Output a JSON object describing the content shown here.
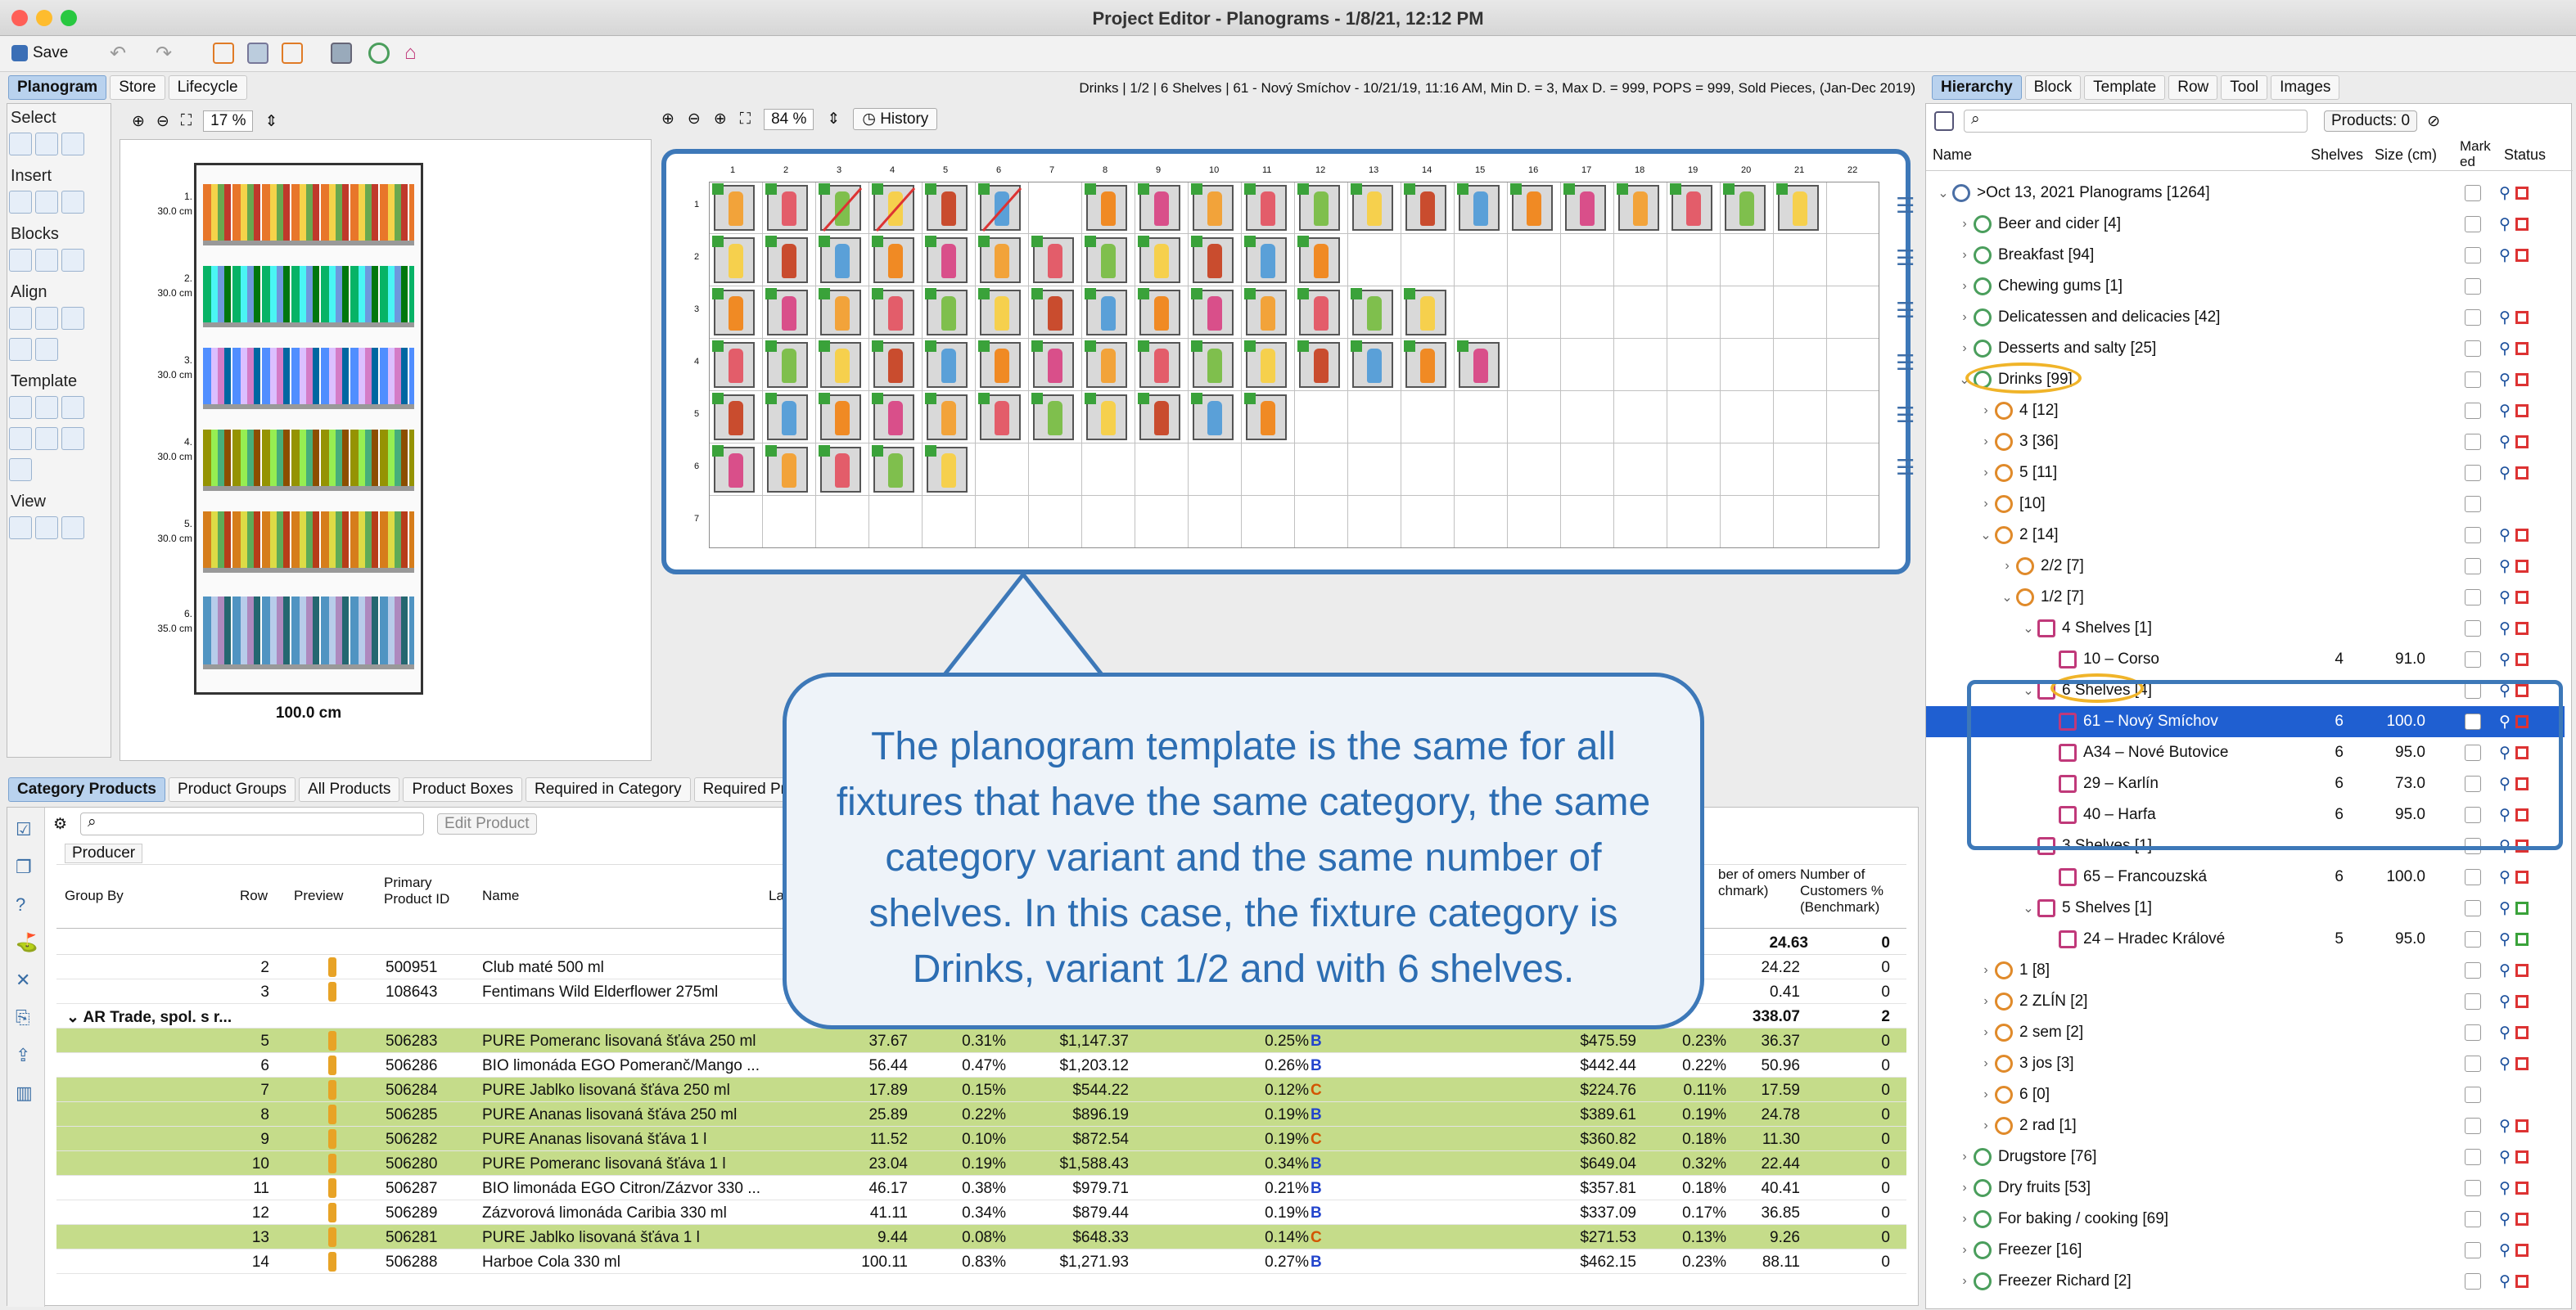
{
  "window": {
    "title": "Project Editor - Planograms - 1/8/21, 12:12 PM"
  },
  "toolbar": {
    "save_label": "Save"
  },
  "left_tabs": [
    "Planogram",
    "Store",
    "Lifecycle"
  ],
  "left_panel": {
    "zoom": "17 %",
    "sections": [
      "Select",
      "Insert",
      "Blocks",
      "Align",
      "Template",
      "View"
    ],
    "shelf_labels": [
      "1.",
      "2.",
      "3.",
      "4.",
      "5.",
      "6."
    ],
    "shelf_heights": [
      "30.0 cm",
      "30.0 cm",
      "30.0 cm",
      "30.0 cm",
      "30.0 cm",
      "35.0 cm"
    ],
    "width_label": "100.0 cm"
  },
  "center": {
    "info": "Drinks | 1/2 | 6 Shelves | 61 - Nový Smíchov - 10/21/19, 11:16 AM, Min D. = 3, Max D. = 999, POPS = 999, Sold Pieces, (Jan-Dec 2019)",
    "zoom": "84 %",
    "history_label": "History",
    "col_numbers": [
      "1",
      "2",
      "3",
      "4",
      "5",
      "6",
      "7",
      "8",
      "9",
      "10",
      "11",
      "12",
      "13",
      "14",
      "15",
      "16",
      "17",
      "18",
      "19",
      "20",
      "21",
      "22"
    ],
    "row_numbers": [
      "1",
      "2",
      "3",
      "4",
      "5",
      "6",
      "7"
    ]
  },
  "right_tabs": [
    "Hierarchy",
    "Block",
    "Template",
    "Row",
    "Tool",
    "Images"
  ],
  "right_panel": {
    "products_count": "Products: 0",
    "columns": [
      "Name",
      "Shelves",
      "Size (cm)",
      "Mark ed",
      "Status"
    ],
    "rows": [
      {
        "indent": 0,
        "tri": "v",
        "label": ">Oct 13, 2021 Planograms [1264]",
        "shelves": "",
        "size": ""
      },
      {
        "indent": 1,
        "tri": ">",
        "label": "Beer and cider [4]",
        "shelves": "",
        "size": ""
      },
      {
        "indent": 1,
        "tri": ">",
        "label": "Breakfast [94]",
        "shelves": "",
        "size": ""
      },
      {
        "indent": 1,
        "tri": ">",
        "label": "Chewing gums [1]",
        "shelves": "",
        "size": ""
      },
      {
        "indent": 1,
        "tri": ">",
        "label": "Delicatessen and delicacies [42]",
        "shelves": "",
        "size": ""
      },
      {
        "indent": 1,
        "tri": ">",
        "label": "Desserts and salty [25]",
        "shelves": "",
        "size": ""
      },
      {
        "indent": 1,
        "tri": "v",
        "label": "Drinks [99]",
        "shelves": "",
        "size": ""
      },
      {
        "indent": 2,
        "tri": ">",
        "label": "4 [12]",
        "shelves": "",
        "size": ""
      },
      {
        "indent": 2,
        "tri": ">",
        "label": "3 [36]",
        "shelves": "",
        "size": ""
      },
      {
        "indent": 2,
        "tri": ">",
        "label": "5 [11]",
        "shelves": "",
        "size": ""
      },
      {
        "indent": 2,
        "tri": ">",
        "label": "[10]",
        "shelves": "",
        "size": ""
      },
      {
        "indent": 2,
        "tri": "v",
        "label": "2 [14]",
        "shelves": "",
        "size": ""
      },
      {
        "indent": 3,
        "tri": ">",
        "label": "2/2 [7]",
        "shelves": "",
        "size": ""
      },
      {
        "indent": 3,
        "tri": "v",
        "label": "1/2 [7]",
        "shelves": "",
        "size": ""
      },
      {
        "indent": 4,
        "tri": "v",
        "label": "4 Shelves [1]",
        "shelves": "",
        "size": ""
      },
      {
        "indent": 5,
        "tri": "",
        "label": "10 – Corso",
        "shelves": "4",
        "size": "91.0"
      },
      {
        "indent": 4,
        "tri": "v",
        "label": "6 Shelves [4]",
        "shelves": "",
        "size": ""
      },
      {
        "indent": 5,
        "tri": "",
        "label": "61 – Nový Smíchov",
        "shelves": "6",
        "size": "100.0"
      },
      {
        "indent": 5,
        "tri": "",
        "label": "A34 – Nové Butovice",
        "shelves": "6",
        "size": "95.0"
      },
      {
        "indent": 5,
        "tri": "",
        "label": "29 – Karlín",
        "shelves": "6",
        "size": "73.0"
      },
      {
        "indent": 5,
        "tri": "",
        "label": "40 – Harfa",
        "shelves": "6",
        "size": "95.0"
      },
      {
        "indent": 4,
        "tri": "v",
        "label": "3 Shelves [1]",
        "shelves": "",
        "size": ""
      },
      {
        "indent": 5,
        "tri": "",
        "label": "65 – Francouzská",
        "shelves": "6",
        "size": "100.0"
      },
      {
        "indent": 4,
        "tri": "v",
        "label": "5 Shelves [1]",
        "shelves": "",
        "size": ""
      },
      {
        "indent": 5,
        "tri": "",
        "label": "24 – Hradec Králové",
        "shelves": "5",
        "size": "95.0"
      },
      {
        "indent": 2,
        "tri": ">",
        "label": "1 [8]",
        "shelves": "",
        "size": ""
      },
      {
        "indent": 2,
        "tri": ">",
        "label": "2 ZLÍN [2]",
        "shelves": "",
        "size": ""
      },
      {
        "indent": 2,
        "tri": ">",
        "label": "2 sem [2]",
        "shelves": "",
        "size": ""
      },
      {
        "indent": 2,
        "tri": ">",
        "label": "3 jos [3]",
        "shelves": "",
        "size": ""
      },
      {
        "indent": 2,
        "tri": ">",
        "label": "6 [0]",
        "shelves": "",
        "size": ""
      },
      {
        "indent": 2,
        "tri": ">",
        "label": "2 rad [1]",
        "shelves": "",
        "size": ""
      },
      {
        "indent": 1,
        "tri": ">",
        "label": "Drugstore [76]",
        "shelves": "",
        "size": ""
      },
      {
        "indent": 1,
        "tri": ">",
        "label": "Dry fruits [53]",
        "shelves": "",
        "size": ""
      },
      {
        "indent": 1,
        "tri": ">",
        "label": "For baking / cooking [69]",
        "shelves": "",
        "size": ""
      },
      {
        "indent": 1,
        "tri": ">",
        "label": "Freezer [16]",
        "shelves": "",
        "size": ""
      },
      {
        "indent": 1,
        "tri": ">",
        "label": "Freezer Richard [2]",
        "shelves": "",
        "size": ""
      }
    ]
  },
  "bottom_tabs": [
    "Category Products",
    "Product Groups",
    "All Products",
    "Product Boxes",
    "Required in Category",
    "Required Products"
  ],
  "bottom": {
    "edit_product_label": "Edit Product",
    "producer_label": "Producer",
    "headers": [
      "Group By",
      "Row",
      "Preview",
      "Primary Product ID",
      "Name",
      "La",
      "ber of omers chmark)",
      "Number of Customers % (Benchmark)"
    ],
    "summary_row_values": [
      "24.63",
      "0"
    ],
    "group_label": "AR Trade, spol. s r...",
    "group_values": [
      "338.07",
      "2"
    ],
    "rows": [
      {
        "row": "2",
        "id": "500951",
        "name": "Club maté 500 ml",
        "c1": "",
        "c2": "",
        "c3": "",
        "c4": "",
        "c5": "",
        "c6": "",
        "c7": "24.22",
        "c8": "0",
        "green": false,
        "grade": ""
      },
      {
        "row": "3",
        "id": "108643",
        "name": "Fentimans Wild Elderflower 275ml",
        "c1": "",
        "c2": "",
        "c3": "",
        "c4": "",
        "c5": "",
        "c6": "",
        "c7": "0.41",
        "c8": "0",
        "green": false,
        "grade": ""
      },
      {
        "row": "5",
        "id": "506283",
        "name": "PURE Pomeranc lisovaná šťáva 250 ml",
        "c1": "37.67",
        "c2": "0.31%",
        "c3": "$1,147.37",
        "c4": "0.25%",
        "c5": "$475.59",
        "c6": "0.23%",
        "c7": "36.37",
        "c8": "0",
        "green": true,
        "grade": "B"
      },
      {
        "row": "6",
        "id": "506286",
        "name": "BIO limonáda EGO Pomeranč/Mango ...",
        "c1": "56.44",
        "c2": "0.47%",
        "c3": "$1,203.12",
        "c4": "0.26%",
        "c5": "$442.44",
        "c6": "0.22%",
        "c7": "50.96",
        "c8": "0",
        "green": false,
        "grade": "B"
      },
      {
        "row": "7",
        "id": "506284",
        "name": "PURE Jablko lisovaná šťáva 250 ml",
        "c1": "17.89",
        "c2": "0.15%",
        "c3": "$544.22",
        "c4": "0.12%",
        "c5": "$224.76",
        "c6": "0.11%",
        "c7": "17.59",
        "c8": "0",
        "green": true,
        "grade": "C"
      },
      {
        "row": "8",
        "id": "506285",
        "name": "PURE Ananas lisovaná šťáva 250 ml",
        "c1": "25.89",
        "c2": "0.22%",
        "c3": "$896.19",
        "c4": "0.19%",
        "c5": "$389.61",
        "c6": "0.19%",
        "c7": "24.78",
        "c8": "0",
        "green": true,
        "grade": "B"
      },
      {
        "row": "9",
        "id": "506282",
        "name": "PURE Ananas lisovaná šťáva 1 l",
        "c1": "11.52",
        "c2": "0.10%",
        "c3": "$872.54",
        "c4": "0.19%",
        "c5": "$360.82",
        "c6": "0.18%",
        "c7": "11.30",
        "c8": "0",
        "green": true,
        "grade": "C"
      },
      {
        "row": "10",
        "id": "506280",
        "name": "PURE Pomeranc lisovaná šťáva 1 l",
        "c1": "23.04",
        "c2": "0.19%",
        "c3": "$1,588.43",
        "c4": "0.34%",
        "c5": "$649.04",
        "c6": "0.32%",
        "c7": "22.44",
        "c8": "0",
        "green": true,
        "grade": "B"
      },
      {
        "row": "11",
        "id": "506287",
        "name": "BIO limonáda EGO Citron/Zázvor 330 ...",
        "c1": "46.17",
        "c2": "0.38%",
        "c3": "$979.71",
        "c4": "0.21%",
        "c5": "$357.81",
        "c6": "0.18%",
        "c7": "40.41",
        "c8": "0",
        "green": false,
        "grade": "B"
      },
      {
        "row": "12",
        "id": "506289",
        "name": "Zázvorová limonáda Caribia 330 ml",
        "c1": "41.11",
        "c2": "0.34%",
        "c3": "$879.44",
        "c4": "0.19%",
        "c5": "$337.09",
        "c6": "0.17%",
        "c7": "36.85",
        "c8": "0",
        "green": false,
        "grade": "B"
      },
      {
        "row": "13",
        "id": "506281",
        "name": "PURE Jablko lisovaná šťáva 1 l",
        "c1": "9.44",
        "c2": "0.08%",
        "c3": "$648.33",
        "c4": "0.14%",
        "c5": "$271.53",
        "c6": "0.13%",
        "c7": "9.26",
        "c8": "0",
        "green": true,
        "grade": "C"
      },
      {
        "row": "14",
        "id": "506288",
        "name": "Harboe Cola 330 ml",
        "c1": "100.11",
        "c2": "0.83%",
        "c3": "$1,271.93",
        "c4": "0.27%",
        "c5": "$462.15",
        "c6": "0.23%",
        "c7": "88.11",
        "c8": "0",
        "green": false,
        "grade": "B"
      }
    ]
  },
  "callout": {
    "text": "The planogram template is the same for all fixtures that have the same category, the same category variant and the same number of shelves. In this case, the fixture category is Drinks, variant 1/2 and with 6 shelves."
  },
  "colors": {
    "accent": "#3d78b8",
    "selection": "#1f5fd1",
    "highlight_row": "#c5dc8a",
    "product_marker": "#3aa23a"
  }
}
